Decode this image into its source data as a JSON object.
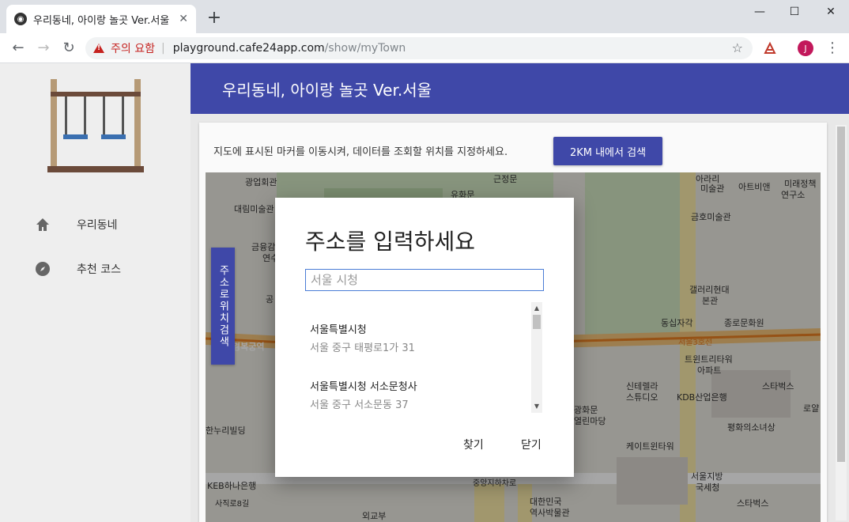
{
  "browser": {
    "tab_title": "우리동네, 아이랑 놀곳 Ver.서울",
    "tab_close": "✕",
    "new_tab": "+",
    "warning_text": "주의 요함",
    "url_host": "playground.cafe24app.com",
    "url_path": "/show/myTown",
    "avatar_letter": "J",
    "win_min": "—",
    "win_max": "☐",
    "win_close": "✕"
  },
  "app": {
    "title": "우리동네, 아이랑 놀곳 Ver.서울",
    "sidebar": {
      "items": [
        {
          "label": "우리동네",
          "icon": "home-icon"
        },
        {
          "label": "추천 코스",
          "icon": "compass-icon"
        }
      ]
    },
    "instruction": "지도에 표시된 마커를 이동시켜, 데이터를 조회할 위치를 지정하세요.",
    "search_button": "2KM 내에서 검색",
    "vertical_button": "주소로위치검색",
    "map_labels": [
      "광업회관",
      "대림미술관",
      "금융감",
      "연수",
      "공",
      "근정문",
      "유화문",
      "아라리",
      "미술관",
      "아트비앤",
      "미래정책",
      "연구소",
      "금호미술관",
      "갤러리현대",
      "본관",
      "동십자각",
      "종로문화원",
      "서울3호선",
      "트윈트리타워",
      "아파트",
      "신테렐라",
      "스튜디오",
      "KDB산업은행",
      "스타벅스",
      "로얄",
      "평화의소녀상",
      "케이트윈타워",
      "서울지방",
      "국세청",
      "스타벅스",
      "한누리빌딩",
      "KEB하나은행",
      "사직로8길",
      "외교부",
      "대한민국",
      "역사박물관",
      "경복궁역",
      "광화문",
      "열린마당",
      "중앙지하차로"
    ]
  },
  "dialog": {
    "title": "주소를 입력하세요",
    "input_placeholder": "서울 시청",
    "results": [
      {
        "name": "서울특별시청",
        "address": "서울 중구 태평로1가 31"
      },
      {
        "name": "서울특별시청 서소문청사",
        "address": "서울 중구 서소문동 37"
      }
    ],
    "find_label": "찾기",
    "close_label": "닫기"
  }
}
